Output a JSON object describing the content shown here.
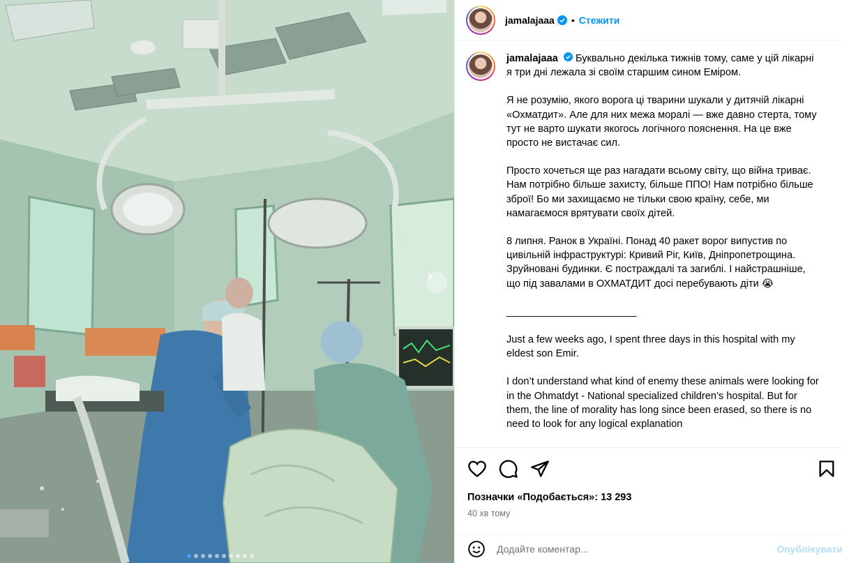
{
  "post": {
    "username": "jamalajaaa",
    "separator": "•",
    "follow_label": "Стежити",
    "verified_icon": "verified-badge-icon"
  },
  "caption": {
    "username": "jamalajaaa",
    "first": "Буквально декілька тижнів тому, саме у цій лікарні я три дні лежала зі своїм старшим сином Еміром.",
    "paragraphs": [
      "Я не розумію, якого ворога ці тварини шукали у дитячій лікарні «Охматдит». Але для них межа моралі — вже давно стерта, тому тут не варто шукати якогось логічного пояснення. На це вже просто не вистачає сил.",
      "Просто хочеться ще раз нагадати всьому світу, що війна триває. Нам потрібно більше захисту, більше ППО! Нам потрібно більше зброї! Бо ми захищаємо не тільки свою країну, себе, ми намагаємося врятувати своїх дітей.",
      "8 липня. Ранок в Україні. Понад 40 ракет ворог випустив по цивільній інфраструктурі: Кривий Ріг, Київ, Дніпропетрощина. Зруйновані будинки. Є постраждалі та загиблі. І найстрашніше, що під завалами в ОХМАТДИТ досі перебувають діти 😭",
      "_______________________",
      "Just a few weeks ago, I spent three days in this hospital with my eldest son Emir.",
      "I don’t understand what kind of enemy these animals were looking for in the Ohmatdyt - National specialized children’s hospital. But for them, the line of morality has long since been erased, so there is no need to look for any logical explanation"
    ]
  },
  "actions": {
    "like_icon": "heart-icon",
    "comment_icon": "comment-icon",
    "share_icon": "share-icon",
    "save_icon": "bookmark-icon"
  },
  "likes_text": "Позначки «Подобається»: 13 293",
  "time_text": "40 хв тому",
  "comment": {
    "placeholder": "Додайте коментар...",
    "publish_label": "Опублікувати",
    "emoji_icon": "emoji-icon"
  },
  "media": {
    "next_icon": "chevron-right-icon",
    "slide_count": 10,
    "active_slide": 1
  }
}
